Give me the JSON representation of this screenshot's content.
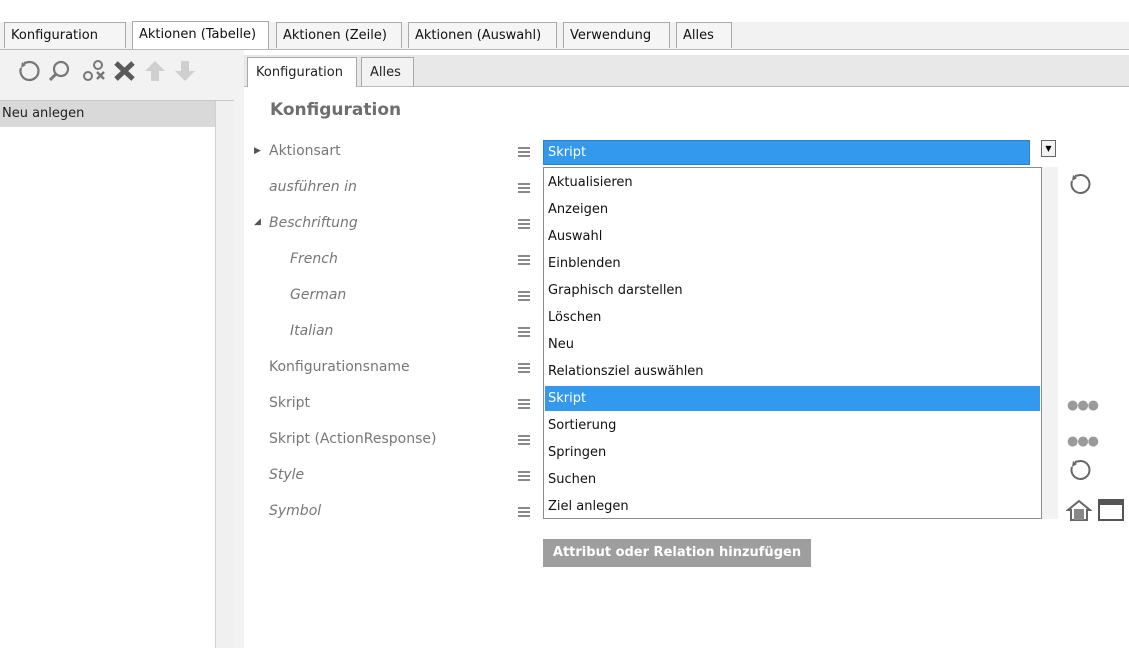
{
  "top_tabs": [
    "Konfiguration",
    "Aktionen (Tabelle)",
    "Aktionen (Zeile)",
    "Aktionen (Auswahl)",
    "Verwendung",
    "Alles"
  ],
  "toolbar_icons": [
    "refresh-icon",
    "search-icon",
    "link-remove-icon",
    "delete-icon",
    "move-up-icon",
    "move-down-icon"
  ],
  "list": {
    "items": [
      "Neu anlegen"
    ]
  },
  "inner_tabs": [
    "Konfiguration",
    "Alles"
  ],
  "section_title": "Konfiguration",
  "rows": [
    {
      "label": "Aktionsart",
      "italic": false,
      "expander": "collapsed"
    },
    {
      "label": "ausführen in",
      "italic": true
    },
    {
      "label": "Beschriftung",
      "italic": true,
      "expander": "expanded"
    },
    {
      "label": "French",
      "italic": true
    },
    {
      "label": "German",
      "italic": true
    },
    {
      "label": "Italian",
      "italic": true
    },
    {
      "label": "Konfigurationsname",
      "italic": false
    },
    {
      "label": "Skript",
      "italic": false
    },
    {
      "label": "Skript (ActionResponse)",
      "italic": false
    },
    {
      "label": "Style",
      "italic": true
    },
    {
      "label": "Symbol",
      "italic": true
    }
  ],
  "aktionsart_select": {
    "value": "Skript",
    "options": [
      "Aktualisieren",
      "Anzeigen",
      "Auswahl",
      "Einblenden",
      "Graphisch darstellen",
      "Löschen",
      "Neu",
      "Relationsziel auswählen",
      "Skript",
      "Sortierung",
      "Springen",
      "Suchen",
      "Ziel anlegen"
    ],
    "selected_index": 8
  },
  "add_button": "Attribut oder Relation hinzufügen",
  "colors": {
    "accent": "#3399ee",
    "button_gray": "#9e9e9e",
    "label_gray": "#777777"
  }
}
